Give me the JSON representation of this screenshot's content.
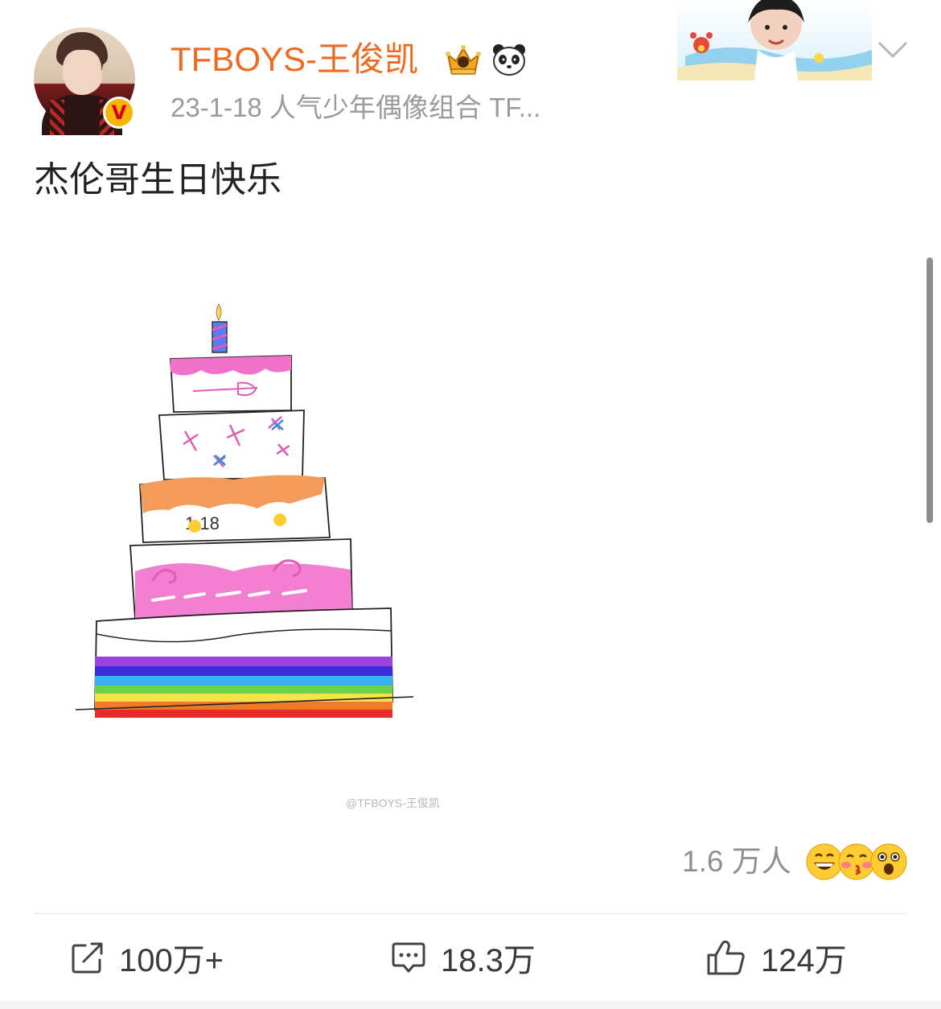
{
  "post": {
    "username": "TFBOYS-王俊凯",
    "meta": "23-1-18  人气少年偶像组合 TF...",
    "text": "杰伦哥生日快乐",
    "watermark": "@TFBOYS-王俊凯",
    "verified_mark": "V"
  },
  "reactions": {
    "count": "1.6 万人",
    "emojis": [
      "laugh-emoji",
      "kiss-emoji",
      "surprised-emoji"
    ]
  },
  "actions": {
    "repost": "100万+",
    "comment": "18.3万",
    "like": "124万"
  },
  "colors": {
    "username": "#ee6a1f",
    "meta": "#9a9a9a",
    "badge": "#f7b500"
  }
}
